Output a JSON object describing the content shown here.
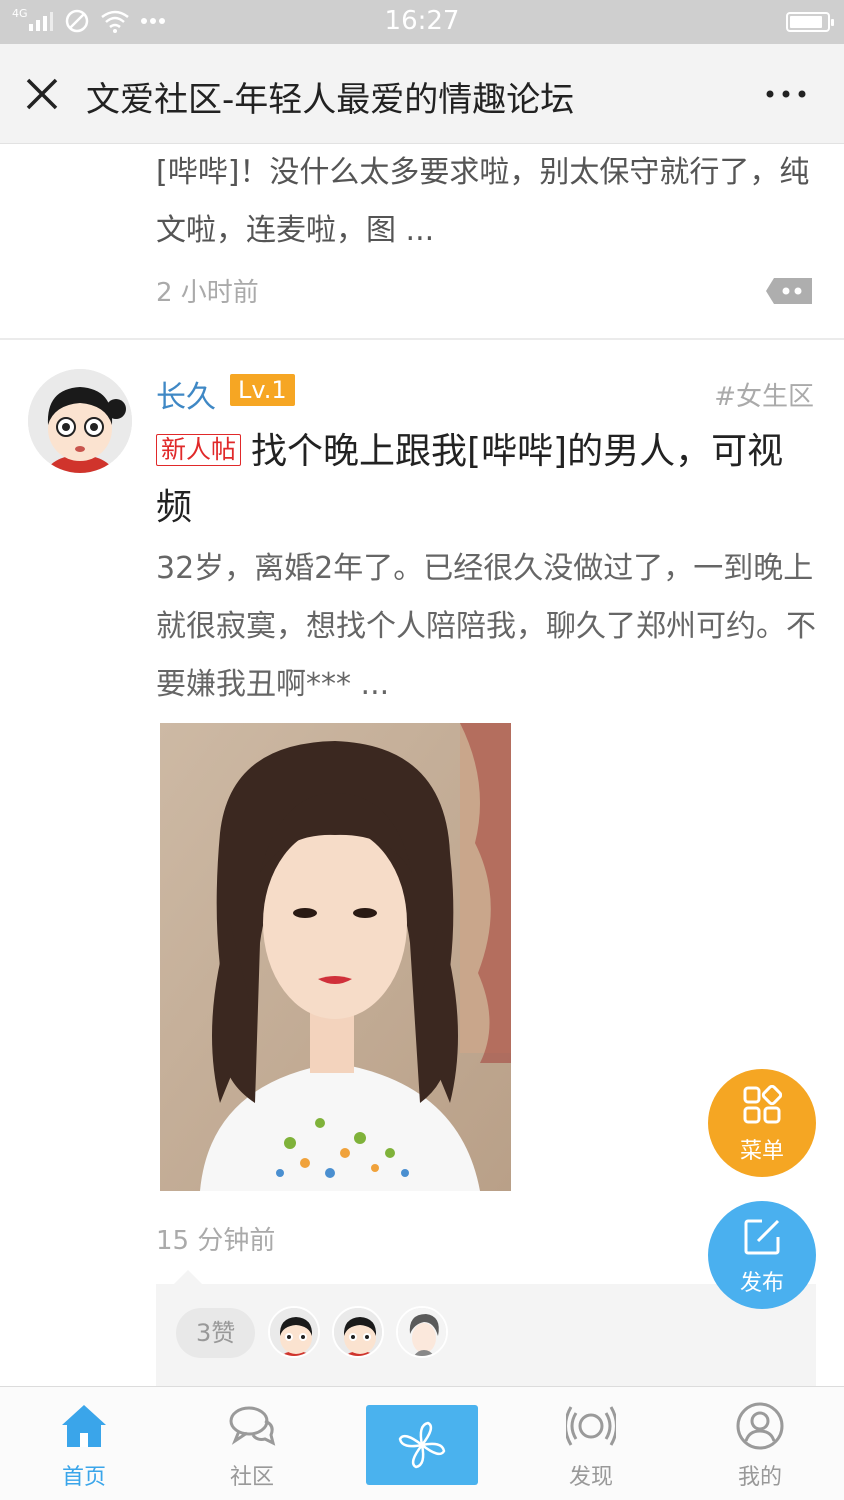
{
  "status_bar": {
    "network": "4G",
    "time": "16:27",
    "battery_level": 0.9
  },
  "nav": {
    "title": "文爱社区-年轻人最爱的情趣论坛"
  },
  "prev_post": {
    "excerpt": "[哔哔]！没什么太多要求啦，别太保守就行了，纯文啦，连麦啦，图 ...",
    "time": "2 小时前"
  },
  "post": {
    "username": "长久",
    "level": "Lv.1",
    "forum": "#女生区",
    "new_tag": "新人帖",
    "title": "找个晚上跟我[哔哔]的男人，可视频",
    "body": "32岁，离婚2年了。已经很久没做过了，一到晚上就很寂寞，想找个人陪陪我，聊久了郑州可约。不要嫌我丑啊*** ...",
    "time": "15 分钟前",
    "likes": "3赞"
  },
  "fab": {
    "menu_label": "菜单",
    "post_label": "发布"
  },
  "tabs": [
    {
      "label": "首页",
      "icon": "home-icon",
      "active": true
    },
    {
      "label": "社区",
      "icon": "chat-icon",
      "active": false
    },
    {
      "label": "",
      "icon": "pinwheel-icon",
      "active": false
    },
    {
      "label": "发现",
      "icon": "broadcast-icon",
      "active": false
    },
    {
      "label": "我的",
      "icon": "profile-icon",
      "active": false
    }
  ],
  "colors": {
    "accent": "#3aa5ea",
    "menu_fab": "#f5a623",
    "level_badge": "#f6a623",
    "new_tag": "#e0292a"
  }
}
